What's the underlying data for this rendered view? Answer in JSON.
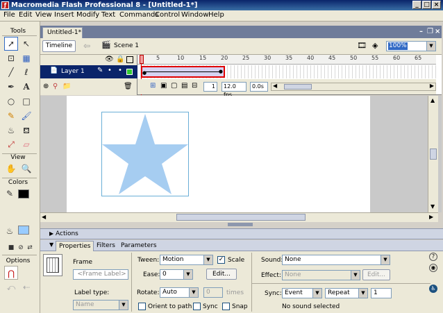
{
  "window": {
    "title": "Macromedia Flash Professional 8 - [Untitled-1*]",
    "app_icon": "flash-icon",
    "controls": [
      "_",
      "□",
      "×"
    ]
  },
  "menu": [
    "File",
    "Edit",
    "View",
    "Insert",
    "Modify",
    "Text",
    "Commands",
    "Control",
    "Window",
    "Help"
  ],
  "tools": {
    "header": "Tools",
    "view_header": "View",
    "colors_header": "Colors",
    "options_header": "Options",
    "items": [
      "selection",
      "subselection",
      "free-transform",
      "fill-transform",
      "line",
      "lasso",
      "pen",
      "text",
      "oval",
      "rectangle",
      "pencil",
      "brush",
      "ink-bottle",
      "paint-bucket",
      "eyedropper",
      "eraser"
    ],
    "stroke_color": "#000000",
    "fill_color": "#99ccff"
  },
  "document": {
    "tab": "Untitled-1*",
    "timeline_button": "Timeline",
    "scene": "Scene 1",
    "zoom": "100%"
  },
  "timeline": {
    "layer_name": "Layer 1",
    "ruler_ticks": [
      "1",
      "5",
      "10",
      "15",
      "20",
      "25",
      "30",
      "35",
      "40",
      "45",
      "50",
      "55",
      "60",
      "65"
    ],
    "current_frame": "1",
    "fps": "12.0 fps",
    "elapsed": "0.0s",
    "tween_start_frame": 1,
    "tween_end_frame": 20,
    "tween_color": "#d6d2f2",
    "selection_border_color": "#e00000"
  },
  "stage": {
    "star_color": "#a6cdf1",
    "bbox_color": "#6aaed6"
  },
  "panels": {
    "actions": "Actions",
    "tabs": [
      "Properties",
      "Filters",
      "Parameters"
    ]
  },
  "properties": {
    "symbol_label": "Frame",
    "frame_label_placeholder": "<Frame Label>",
    "label_type_label": "Label type:",
    "label_type_value": "Name",
    "tween_label": "Tween:",
    "tween_value": "Motion",
    "scale_label": "Scale",
    "scale_checked": "✓",
    "ease_label": "Ease:",
    "ease_value": "0",
    "edit_button": "Edit...",
    "rotate_label": "Rotate:",
    "rotate_value": "Auto",
    "rotate_times_value": "0",
    "times_label": "times",
    "orient_label": "Orient to path",
    "sync_chk_label": "Sync",
    "snap_label": "Snap",
    "sound_label": "Sound:",
    "sound_value": "None",
    "effect_label": "Effect:",
    "effect_value": "None",
    "effect_edit_button": "Edit...",
    "sync_label": "Sync:",
    "sync_value": "Event",
    "repeat_value": "Repeat",
    "repeat_count": "1",
    "sound_status": "No sound selected"
  }
}
